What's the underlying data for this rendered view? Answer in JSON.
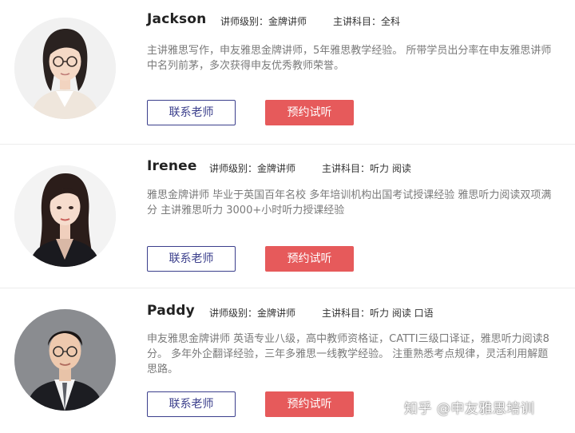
{
  "teachers": [
    {
      "name": "Jackson",
      "level": "讲师级别：金牌讲师",
      "subject": "主讲科目：全科",
      "description": "主讲雅思写作，申友雅思金牌讲师，5年雅思教学经验。 所带学员出分率在申友雅思讲师中名列前茅，多次获得申友优秀教师荣誉。",
      "contact_label": "联系老师",
      "trial_label": "预约试听"
    },
    {
      "name": "Irenee",
      "level": "讲师级别：金牌讲师",
      "subject": "主讲科目：听力 阅读",
      "description": "雅思金牌讲师 毕业于英国百年名校 多年培训机构出国考试授课经验 雅思听力阅读双项满分 主讲雅思听力 3000+小时听力授课经验",
      "contact_label": "联系老师",
      "trial_label": "预约试听"
    },
    {
      "name": "Paddy",
      "level": "讲师级别：金牌讲师",
      "subject": "主讲科目：听力 阅读 口语",
      "description": "申友雅思金牌讲师 英语专业八级，高中教师资格证，CATTI三级口译证，雅思听力阅读8分。 多年外企翻译经验，三年多雅思一线教学经验。 注重熟悉考点规律，灵活利用解题思路。",
      "contact_label": "联系老师",
      "trial_label": "预约试听"
    }
  ],
  "watermark": "知乎 @申友雅思培训",
  "colors": {
    "contact_border": "#3b3f8c",
    "trial_background": "#e65a5b",
    "description_text": "#7a7a7a"
  }
}
